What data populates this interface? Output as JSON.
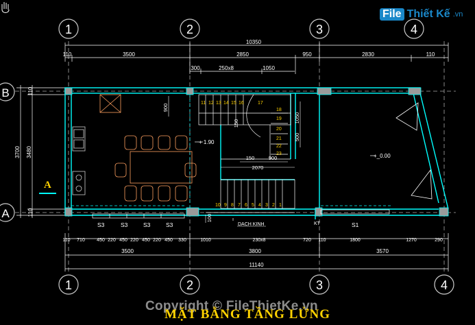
{
  "logo": {
    "box": "File",
    "brand": "Thiết Kế",
    "domain": ".vn"
  },
  "grid_bubbles_top": [
    "1",
    "2",
    "3",
    "4"
  ],
  "grid_bubbles_bottom": [
    "1",
    "2",
    "3",
    "4"
  ],
  "grid_bubbles_left": [
    "B",
    "A"
  ],
  "dims_top": {
    "total": "10350",
    "row1": [
      "110",
      "3500",
      "2850",
      "950",
      "2830",
      "110"
    ],
    "row2": [
      "300",
      "250x8",
      "1050"
    ]
  },
  "dims_left": [
    "110",
    "3700",
    "3480",
    "110"
  ],
  "dims_bottom": {
    "row1": [
      "110",
      "710",
      "450",
      "220",
      "450",
      "220",
      "450",
      "220",
      "450",
      "330",
      "1010",
      "230x8",
      "720",
      "110",
      "1800",
      "1270",
      "290"
    ],
    "row2": [
      "3500",
      "3800",
      "3570"
    ],
    "total": "11140"
  },
  "interior": {
    "dim_900": "900",
    "dim_1050": "1050",
    "dim_500": "500",
    "dim_150": "150",
    "dim_900b": "900",
    "dim_2070": "2070",
    "dim_100": "100",
    "level_left": "+ 1.90",
    "level_right": "+_0.00",
    "stair_top": [
      "11",
      "12",
      "13",
      "14",
      "15",
      "16",
      "17",
      "18",
      "19",
      "20",
      "21",
      "22",
      "23"
    ],
    "stair_bottom": [
      "10",
      "9",
      "8",
      "7",
      "6",
      "5",
      "4",
      "3",
      "2",
      "1"
    ],
    "glass_label": "DACH KINH",
    "kt_label": "KT",
    "s1_label": "S1",
    "s3_labels": [
      "S3",
      "S3",
      "S3",
      "S3"
    ],
    "section_mark": "A"
  },
  "watermark": "Copyright © FileThietKe.vn",
  "title": "MẶT BẰNG TẦNG LỬNG",
  "colors": {
    "wall": "#00ffff",
    "dim": "#ffffff",
    "text_yellow": "#ffd200",
    "furniture": "#ffa060",
    "column": "#9a9a9a",
    "stair": "#ffffff",
    "accent": "#ff0000"
  }
}
